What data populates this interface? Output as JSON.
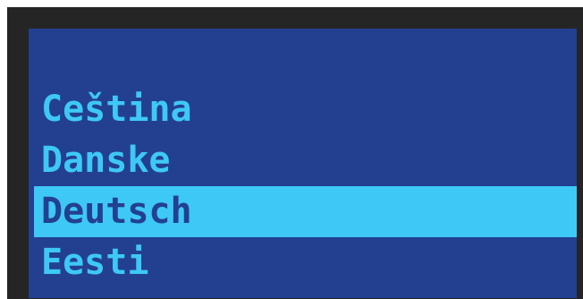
{
  "menu": {
    "items": [
      {
        "label": "Ceština",
        "selected": false
      },
      {
        "label": "Danske",
        "selected": false
      },
      {
        "label": "Deutsch",
        "selected": true
      },
      {
        "label": "Eesti",
        "selected": false
      }
    ]
  },
  "colors": {
    "bezel": "#252525",
    "background": "#234090",
    "text": "#3ec8f5",
    "highlight": "#3ec8f5",
    "highlight_text": "#234090"
  }
}
